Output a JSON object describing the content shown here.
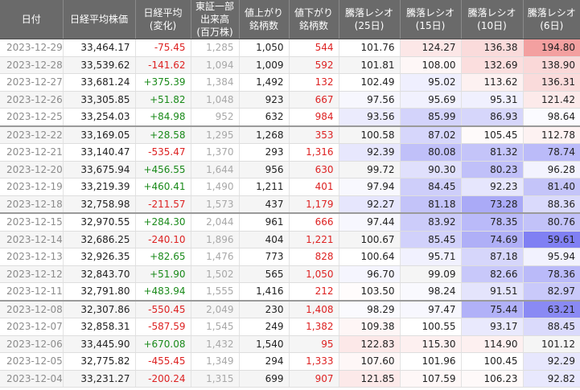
{
  "headers": [
    {
      "line1": "日付",
      "line2": ""
    },
    {
      "line1": "日経平均株価",
      "line2": ""
    },
    {
      "line1": "日経平均",
      "line2": "(変化)"
    },
    {
      "line1": "東証一部",
      "line2": "出来高",
      "line3": "(百万株)"
    },
    {
      "line1": "値上がり",
      "line2": "銘柄数"
    },
    {
      "line1": "値下がり",
      "line2": "銘柄数"
    },
    {
      "line1": "騰落レシオ",
      "line2": "(25日)"
    },
    {
      "line1": "騰落レシオ",
      "line2": "(15日)"
    },
    {
      "line1": "騰落レシオ",
      "line2": "(10日)"
    },
    {
      "line1": "騰落レシオ",
      "line2": "(6日)"
    }
  ],
  "colors": {
    "header_bg": "#6a6a6a",
    "up": "#1a8a1a",
    "down": "#dd2222",
    "high_ratio": "#f3a0a0",
    "low_ratio": "#8080f3"
  },
  "rows": [
    [
      "2023-12-29",
      "33,464.17",
      "-75.45",
      "1,285",
      "1,050",
      "544",
      "101.76",
      "124.27",
      "136.38",
      "194.80"
    ],
    [
      "2023-12-28",
      "33,539.62",
      "-141.62",
      "1,094",
      "1,009",
      "592",
      "101.81",
      "108.00",
      "132.69",
      "138.90"
    ],
    [
      "2023-12-27",
      "33,681.24",
      "+375.39",
      "1,384",
      "1,492",
      "132",
      "102.49",
      "95.02",
      "113.62",
      "136.31"
    ],
    [
      "2023-12-26",
      "33,305.85",
      "+51.82",
      "1,048",
      "923",
      "667",
      "97.56",
      "95.69",
      "95.31",
      "121.42"
    ],
    [
      "2023-12-25",
      "33,254.03",
      "+84.98",
      "952",
      "632",
      "984",
      "93.56",
      "85.99",
      "86.93",
      "98.64"
    ],
    [
      "2023-12-22",
      "33,169.05",
      "+28.58",
      "1,295",
      "1,268",
      "353",
      "100.58",
      "87.02",
      "105.45",
      "112.78"
    ],
    [
      "2023-12-21",
      "33,140.47",
      "-535.47",
      "1,370",
      "293",
      "1,316",
      "92.39",
      "80.08",
      "81.32",
      "78.74"
    ],
    [
      "2023-12-20",
      "33,675.94",
      "+456.55",
      "1,644",
      "956",
      "630",
      "99.72",
      "90.30",
      "80.23",
      "96.28"
    ],
    [
      "2023-12-19",
      "33,219.39",
      "+460.41",
      "1,490",
      "1,211",
      "401",
      "97.94",
      "84.45",
      "92.23",
      "81.40"
    ],
    [
      "2023-12-18",
      "32,758.98",
      "-211.57",
      "1,573",
      "437",
      "1,179",
      "92.27",
      "81.18",
      "73.28",
      "88.36"
    ],
    [
      "2023-12-15",
      "32,970.55",
      "+284.30",
      "2,044",
      "961",
      "666",
      "97.44",
      "83.92",
      "78.35",
      "80.76"
    ],
    [
      "2023-12-14",
      "32,686.25",
      "-240.10",
      "1,896",
      "404",
      "1,221",
      "100.67",
      "85.45",
      "74.69",
      "59.61"
    ],
    [
      "2023-12-13",
      "32,926.35",
      "+82.65",
      "1,476",
      "773",
      "828",
      "100.64",
      "95.71",
      "87.18",
      "95.94"
    ],
    [
      "2023-12-12",
      "32,843.70",
      "+51.90",
      "1,502",
      "565",
      "1,050",
      "96.70",
      "99.09",
      "82.66",
      "78.36"
    ],
    [
      "2023-12-11",
      "32,791.80",
      "+483.94",
      "1,555",
      "1,416",
      "212",
      "103.50",
      "98.24",
      "91.51",
      "82.97"
    ],
    [
      "2023-12-08",
      "32,307.86",
      "-550.45",
      "2,049",
      "230",
      "1,408",
      "98.29",
      "97.47",
      "75.44",
      "63.21"
    ],
    [
      "2023-12-07",
      "32,858.31",
      "-587.59",
      "1,545",
      "249",
      "1,382",
      "109.38",
      "100.55",
      "93.17",
      "88.45"
    ],
    [
      "2023-12-06",
      "33,445.90",
      "+670.08",
      "1,432",
      "1,540",
      "95",
      "122.83",
      "115.30",
      "114.90",
      "101.12"
    ],
    [
      "2023-12-05",
      "32,775.82",
      "-455.45",
      "1,349",
      "294",
      "1,333",
      "107.60",
      "101.96",
      "100.45",
      "92.29"
    ],
    [
      "2023-12-04",
      "33,231.27",
      "-200.24",
      "1,315",
      "699",
      "907",
      "121.85",
      "107.59",
      "106.23",
      "92.82"
    ]
  ]
}
